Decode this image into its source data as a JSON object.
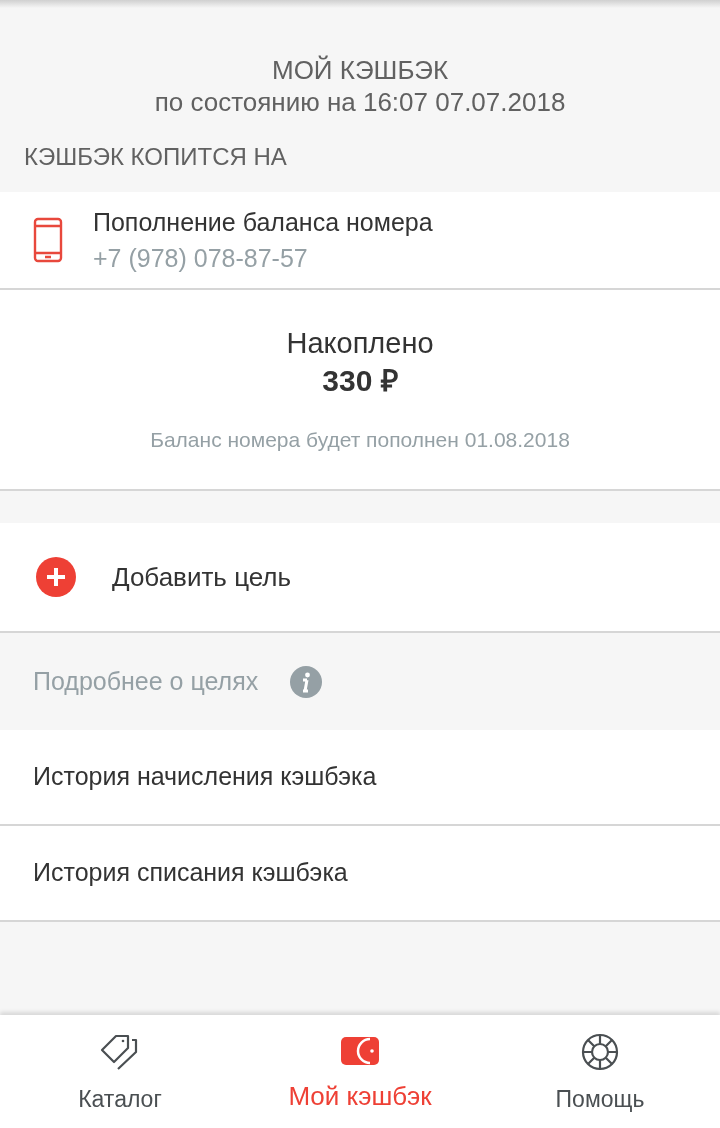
{
  "header": {
    "title": "МОЙ КЭШБЭК",
    "subtitle": "по состоянию на 16:07 07.07.2018"
  },
  "section_title": "КЭШБЭК КОПИТСЯ НА",
  "target": {
    "title": "Пополнение баланса номера",
    "phone": "+7 (978) 078-87-57"
  },
  "accumulated": {
    "label": "Накоплено",
    "amount": "330 ₽",
    "note": "Баланс номера будет пополнен 01.08.2018"
  },
  "add_goal": "Добавить цель",
  "goals_info": "Подробнее о целях",
  "history": [
    "История начисления кэшбэка",
    "История списания кэшбэка"
  ],
  "nav": [
    {
      "label": "Каталог",
      "kind": "tags",
      "selected": false
    },
    {
      "label": "Мой кэшбэк",
      "kind": "wallet",
      "selected": true
    },
    {
      "label": "Помощь",
      "kind": "lifebuoy",
      "selected": false
    }
  ]
}
